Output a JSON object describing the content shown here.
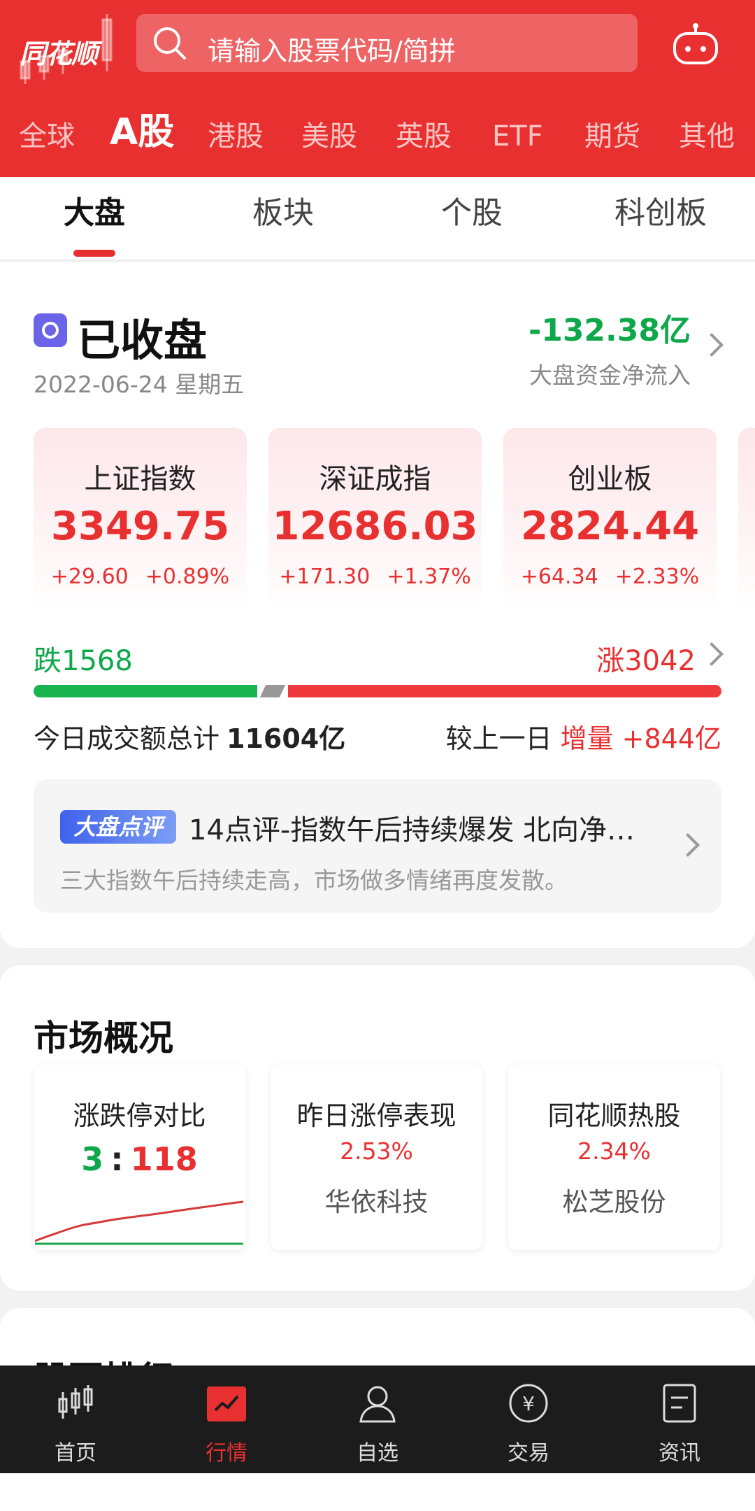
{
  "app": {
    "logo_text": "同花顺",
    "search_placeholder": "请输入股票代码/简拼"
  },
  "market_tabs": [
    "全球",
    "A股",
    "港股",
    "美股",
    "英股",
    "ETF",
    "期货",
    "其他"
  ],
  "sub_tabs": [
    "大盘",
    "板块",
    "个股",
    "科创板"
  ],
  "status": {
    "title": "已收盘",
    "date": "2022-06-24 星期五",
    "net_flow": "-132.38亿",
    "net_flow_label": "大盘资金净流入"
  },
  "indices": [
    {
      "name": "上证指数",
      "value": "3349.75",
      "change": "+29.60",
      "pct": "+0.89%"
    },
    {
      "name": "深证成指",
      "value": "12686.03",
      "change": "+171.30",
      "pct": "+1.37%"
    },
    {
      "name": "创业板",
      "value": "2824.44",
      "change": "+64.34",
      "pct": "+2.33%"
    }
  ],
  "breadth": {
    "fall_label": "跌1568",
    "rise_label": "涨3042",
    "fall": 1568,
    "rise": 3042
  },
  "turnover": {
    "label": "今日成交额总计",
    "value": "11604亿",
    "compare_label": "较上一日",
    "delta_label": "增量",
    "delta": "+844亿"
  },
  "news": {
    "badge": "大盘点评",
    "title": "14点评-指数午后持续爆发 北向净…",
    "subtitle": "三大指数午后持续走高，市场做多情绪再度发散。"
  },
  "market_overview": {
    "title": "市场概况",
    "cards": [
      {
        "title": "涨跌停对比",
        "down": "3",
        "sep": ":",
        "up": "118"
      },
      {
        "title": "昨日涨停表现",
        "pct": "2.53%",
        "stock": "华依科技"
      },
      {
        "title": "同花顺热股",
        "pct": "2.34%",
        "stock": "松芝股份"
      }
    ]
  },
  "next_section_title": "股票排行",
  "bottom_nav": [
    {
      "label": "首页",
      "icon": "candlestick-icon"
    },
    {
      "label": "行情",
      "icon": "trend-chart-icon"
    },
    {
      "label": "自选",
      "icon": "user-icon"
    },
    {
      "label": "交易",
      "icon": "yen-coin-icon"
    },
    {
      "label": "资讯",
      "icon": "document-icon"
    }
  ],
  "colors": {
    "brand_red": "#e93030",
    "up_red": "#e93030",
    "down_green": "#0ea84b"
  }
}
